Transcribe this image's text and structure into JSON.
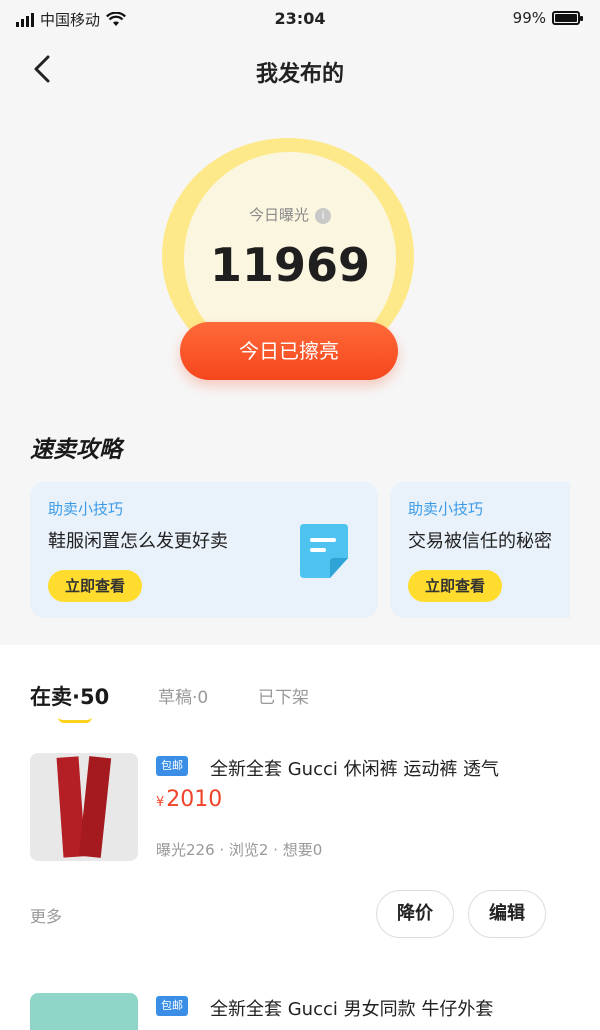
{
  "status_bar": {
    "carrier": "中国移动",
    "time": "23:04",
    "battery": "99%",
    "battery_level": 0.99
  },
  "header": {
    "title": "我发布的"
  },
  "exposure": {
    "label": "今日曝光",
    "value": "11969",
    "button": "今日已擦亮"
  },
  "quick_sale": {
    "title": "速卖攻略",
    "tips": [
      {
        "tag": "助卖小技巧",
        "headline": "鞋服闲置怎么发更好卖",
        "action": "立即查看"
      },
      {
        "tag": "助卖小技巧",
        "headline": "交易被信任的秘密",
        "action": "立即查看"
      }
    ]
  },
  "tabs": [
    {
      "label": "在卖·50",
      "active": true
    },
    {
      "label": "草稿·0",
      "active": false
    },
    {
      "label": "已下架",
      "active": false
    }
  ],
  "items": [
    {
      "badge": "包邮",
      "title": "全新全套 Gucci 休闲裤 运动裤 透气",
      "currency": "¥",
      "price": "2010",
      "stats": "曝光226 · 浏览2 · 想要0",
      "more": "更多",
      "actions": [
        "降价",
        "编辑"
      ]
    },
    {
      "badge": "包邮",
      "title": "全新全套 Gucci 男女同款 牛仔外套"
    }
  ],
  "colors": {
    "accent": "#f5461c",
    "yellow": "#ffdc2e",
    "blue": "#3b9be8",
    "price": "#f0442a"
  }
}
